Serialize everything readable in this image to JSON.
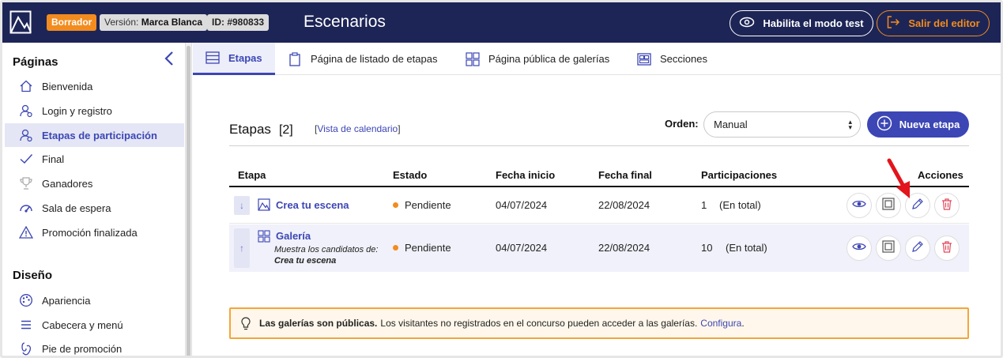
{
  "header": {
    "draft_badge": "Borrador",
    "version_label": "Versión:",
    "version_value": "Marca Blanca",
    "id_badge": "ID: #980833",
    "title": "Escenarios",
    "test_mode_button": "Habilita el modo test",
    "exit_button": "Salir del editor"
  },
  "sidebar": {
    "pages_title": "Páginas",
    "pages": [
      {
        "label": "Bienvenida",
        "icon": "home-icon"
      },
      {
        "label": "Login y registro",
        "icon": "user-login-icon"
      },
      {
        "label": "Etapas de participación",
        "icon": "user-stages-icon"
      },
      {
        "label": "Final",
        "icon": "check-icon"
      },
      {
        "label": "Ganadores",
        "icon": "trophy-icon"
      },
      {
        "label": "Sala de espera",
        "icon": "gauge-icon"
      },
      {
        "label": "Promoción finalizada",
        "icon": "warning-icon"
      }
    ],
    "design_title": "Diseño",
    "design": [
      {
        "label": "Apariencia",
        "icon": "palette-icon"
      },
      {
        "label": "Cabecera y menú",
        "icon": "menu-icon"
      },
      {
        "label": "Pie de promoción",
        "icon": "footer-icon"
      }
    ]
  },
  "tabs": [
    {
      "label": "Etapas",
      "icon": "list-icon"
    },
    {
      "label": "Página de listado de etapas",
      "icon": "clipboard-icon"
    },
    {
      "label": "Página pública de galerías",
      "icon": "grid-icon"
    },
    {
      "label": "Secciones",
      "icon": "sections-icon"
    }
  ],
  "main": {
    "heading": "Etapas",
    "count": "[2]",
    "calendar_link_open": "[",
    "calendar_link": "Vista de calendario",
    "calendar_link_close": "]",
    "order_label": "Orden:",
    "order_value": "Manual",
    "new_stage_button": "Nueva etapa",
    "columns": [
      "Etapa",
      "Estado",
      "Fecha inicio",
      "Fecha final",
      "Participaciones",
      "Acciones"
    ],
    "rows": [
      {
        "move": "↓",
        "name": "Crea tu escena",
        "status": "Pendiente",
        "start": "04/07/2024",
        "end": "22/08/2024",
        "participations": "1",
        "participations_note": "(En total)"
      },
      {
        "move": "↑",
        "name": "Galería",
        "description": "Muestra los candidatos de:",
        "description_ref": "Crea tu escena",
        "status": "Pendiente",
        "start": "04/07/2024",
        "end": "22/08/2024",
        "participations": "10",
        "participations_note": "(En total)"
      }
    ],
    "notice_bold": "Las galerías son públicas.",
    "notice_text": "Los visitantes no registrados en el concurso pueden acceder a las galerías.",
    "notice_link": "Configura",
    "notice_end": "."
  },
  "colors": {
    "topbar": "#1d2556",
    "accent": "#3c46b4",
    "orange": "#f28c1e",
    "danger": "#e0475b"
  }
}
